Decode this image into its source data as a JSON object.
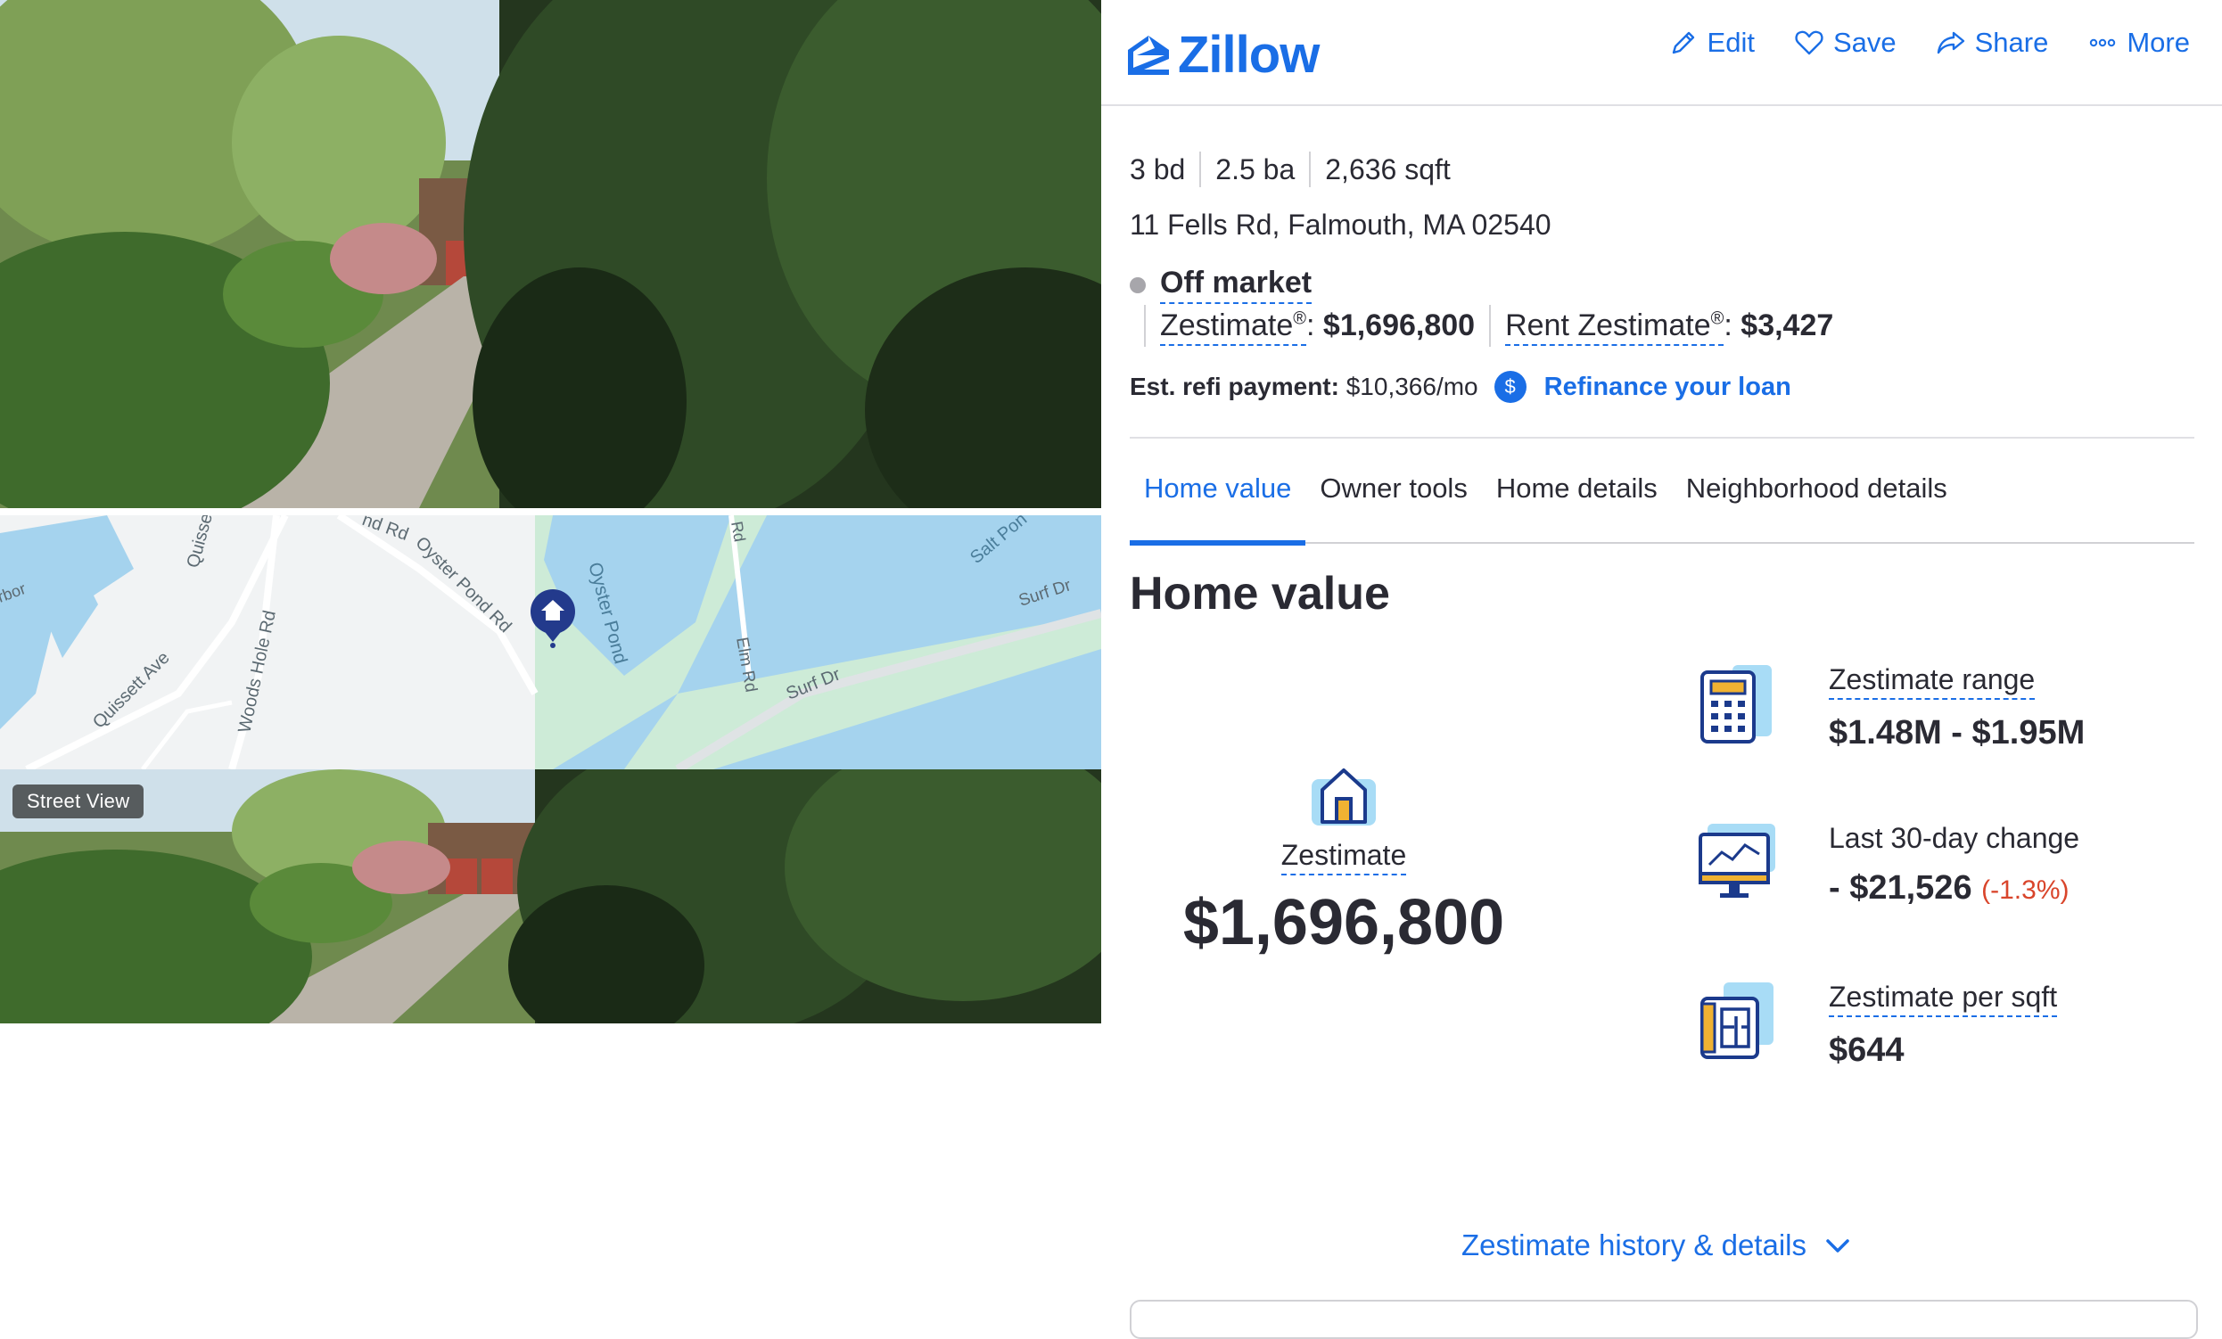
{
  "colors": {
    "brand": "#1a6ee6",
    "text": "#2a2a33",
    "negative": "#d9452b",
    "off_market_dot": "#a7a6ab"
  },
  "media": {
    "street_view_badge": "Street View",
    "map_labels": {
      "harbor": "rbor",
      "quisset_top": "Quisset",
      "pond_rd_top": "nd Rd",
      "oyster_pond_rd": "Oyster Pond Rd",
      "oyster_pond": "Oyster Pond",
      "rd": "Rd",
      "salt_pond": "Salt Pon",
      "surf_dr_right": "Surf Dr",
      "surf_dr": "Surf Dr",
      "elm_rd": "Elm Rd",
      "quissett_ave": "Quissett Ave",
      "woods_hole_rd": "Woods Hole Rd"
    }
  },
  "header": {
    "logo": "Zillow",
    "actions": [
      {
        "label": "Edit",
        "icon": "pencil-icon"
      },
      {
        "label": "Save",
        "icon": "heart-icon"
      },
      {
        "label": "Share",
        "icon": "share-icon"
      },
      {
        "label": "More",
        "icon": "more-dots-icon"
      }
    ]
  },
  "summary": {
    "beds": "3 bd",
    "baths": "2.5 ba",
    "sqft": "2,636 sqft",
    "address": "11 Fells Rd, Falmouth, MA 02540",
    "status": "Off market",
    "zestimate_label": "Zestimate",
    "zestimate_value": "$1,696,800",
    "rent_label": "Rent Zestimate",
    "rent_value": "$3,427",
    "reg_mark": "®",
    "refi_label": "Est. refi payment:",
    "refi_value": "$10,366/mo",
    "refi_link": "Refinance your loan"
  },
  "tabs": [
    "Home value",
    "Owner tools",
    "Home details",
    "Neighborhood details"
  ],
  "home_value": {
    "heading": "Home value",
    "zestimate_label": "Zestimate",
    "zestimate_value": "$1,696,800",
    "stats": [
      {
        "label": "Zestimate range",
        "value": "$1.48M - $1.95M",
        "icon": "calculator-icon"
      },
      {
        "label": "Last 30-day change",
        "value": "- $21,526",
        "change": "(-1.3%)",
        "icon": "monitor-chart-icon"
      },
      {
        "label": "Zestimate per sqft",
        "value": "$644",
        "icon": "floorplan-icon"
      }
    ],
    "history_link": "Zestimate history & details"
  }
}
